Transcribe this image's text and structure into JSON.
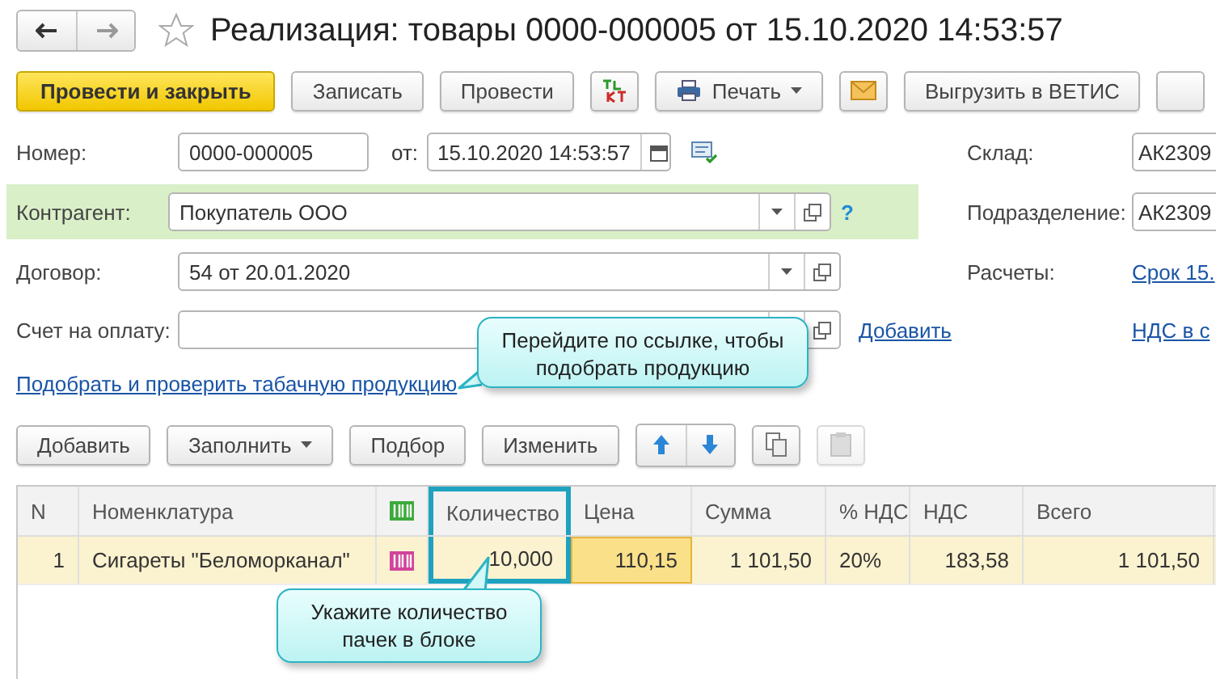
{
  "window": {
    "title": "Реализация: товары 0000-000005 от 15.10.2020 14:53:57",
    "favorite": false
  },
  "toolbar": [
    {
      "kind": "primary",
      "label": "Провести и закрыть"
    },
    {
      "kind": "button",
      "label": "Записать"
    },
    {
      "kind": "button",
      "label": "Провести"
    },
    {
      "kind": "dtkt"
    },
    {
      "kind": "menu",
      "label": "Печать"
    },
    {
      "kind": "mail"
    },
    {
      "kind": "button",
      "label": "Выгрузить в ВЕТИС"
    },
    {
      "kind": "button"
    }
  ],
  "form": {
    "number_label": "Номер:",
    "number": "0000-000005",
    "date_label": "от:",
    "date": "15.10.2020 14:53:57",
    "counterparty_label": "Контрагент:",
    "counterparty": "Покупатель ООО",
    "help": "?",
    "contract_label": "Договор:",
    "contract": "54 от 20.01.2020",
    "invoice_label": "Счет на оплату:",
    "invoice_add_link": "Добавить",
    "tobacco_link": "Подобрать и проверить табачную продукцию"
  },
  "right_panel": {
    "warehouse_label": "Склад:",
    "warehouse": "АК2309",
    "division_label": "Подразделение:",
    "division": "АК2309",
    "settlements_label": "Расчеты:",
    "settlements_link": "Срок 15.",
    "vat_link": "НДС в с"
  },
  "table_toolbar": [
    {
      "kind": "button",
      "label": "Добавить"
    },
    {
      "kind": "menu",
      "label": "Заполнить"
    },
    {
      "kind": "button",
      "label": "Подбор"
    },
    {
      "kind": "button",
      "label": "Изменить"
    },
    {
      "kind": "updown"
    },
    {
      "kind": "copy",
      "disabled": false
    },
    {
      "kind": "paste",
      "disabled": true
    }
  ],
  "table": {
    "columns": [
      {
        "kind": "text",
        "label": "N",
        "highlighted": false
      },
      {
        "kind": "text",
        "label": "Номенклатура",
        "highlighted": false
      },
      {
        "kind": "icon",
        "highlighted": false
      },
      {
        "kind": "text",
        "label": "Количество",
        "highlighted": true
      },
      {
        "kind": "text",
        "label": "Цена",
        "highlighted": false
      },
      {
        "kind": "text",
        "label": "Сумма",
        "highlighted": false
      },
      {
        "kind": "text",
        "label": "% НДС",
        "highlighted": false
      },
      {
        "kind": "text",
        "label": "НДС",
        "highlighted": false
      },
      {
        "kind": "text",
        "label": "Всего",
        "highlighted": false
      }
    ],
    "rows": [
      {
        "selected": true,
        "cells": [
          {
            "kind": "text",
            "text": "1",
            "focused": false
          },
          {
            "kind": "text",
            "text": "Сигареты \"Беломорканал\"",
            "focused": false
          },
          {
            "kind": "icon",
            "focused": false
          },
          {
            "kind": "text",
            "text": "10,000",
            "focused": false
          },
          {
            "kind": "text",
            "text": "110,15",
            "focused": true
          },
          {
            "kind": "text",
            "text": "1 101,50",
            "focused": false
          },
          {
            "kind": "text",
            "text": "20%",
            "focused": false
          },
          {
            "kind": "text",
            "text": "183,58",
            "focused": false
          },
          {
            "kind": "text",
            "text": "1 101,50",
            "focused": false
          }
        ]
      }
    ]
  },
  "callouts": [
    {
      "text": "Перейдите по ссылке, чтобы подобрать продукцию"
    },
    {
      "text": "Укажите количество пачек в блоке"
    }
  ]
}
